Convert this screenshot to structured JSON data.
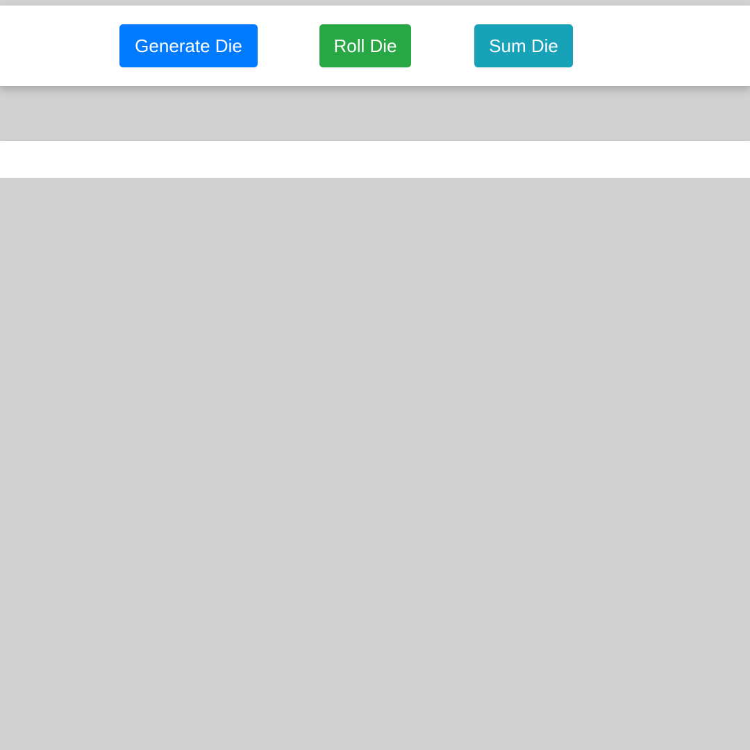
{
  "toolbar": {
    "buttons": [
      {
        "label": "Generate Die",
        "color": "#007bff"
      },
      {
        "label": "Roll Die",
        "color": "#28a745"
      },
      {
        "label": "Sum Die",
        "color": "#17a2b8"
      }
    ]
  },
  "colors": {
    "background": "#d1d1d1",
    "panel": "#ffffff",
    "button_text": "#ffffff"
  }
}
